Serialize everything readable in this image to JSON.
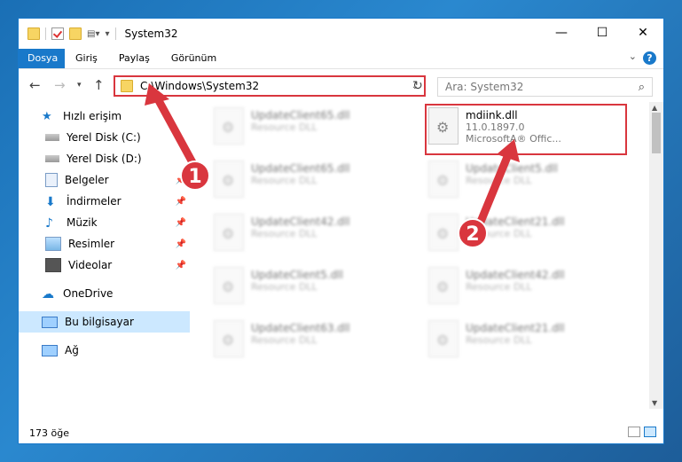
{
  "window": {
    "title": "System32",
    "controls": {
      "minimize": "—",
      "maximize": "☐",
      "close": "✕"
    }
  },
  "ribbon": {
    "tabs": [
      "Dosya",
      "Giriş",
      "Paylaş",
      "Görünüm"
    ],
    "help": "?"
  },
  "address_bar": {
    "path": "C:\\Windows\\System32",
    "search_placeholder": "Ara: System32"
  },
  "sidebar": {
    "items": [
      {
        "label": "Hızlı erişim",
        "icon": "star-icon"
      },
      {
        "label": "Yerel Disk (C:)",
        "icon": "drive-icon"
      },
      {
        "label": "Yerel Disk (D:)",
        "icon": "drive-icon"
      },
      {
        "label": "Belgeler",
        "icon": "documents-icon"
      },
      {
        "label": "İndirmeler",
        "icon": "download-icon"
      },
      {
        "label": "Müzik",
        "icon": "music-icon"
      },
      {
        "label": "Resimler",
        "icon": "pictures-icon"
      },
      {
        "label": "Videolar",
        "icon": "video-icon"
      },
      {
        "label": "OneDrive",
        "icon": "cloud-icon"
      },
      {
        "label": "Bu bilgisayar",
        "icon": "computer-icon"
      },
      {
        "label": "Ağ",
        "icon": "network-icon"
      }
    ]
  },
  "files": {
    "highlighted": {
      "name": "mdiink.dll",
      "version": "11.0.1897.0",
      "company": "MicrosoftA® Offic..."
    },
    "left_column": [
      {
        "name": "UpdateClient65.dll",
        "type": "Resource DLL"
      },
      {
        "name": "UpdateClient65.dll",
        "type": "Resource DLL"
      },
      {
        "name": "UpdateClient42.dll",
        "type": "Resource DLL"
      },
      {
        "name": "UpdateClient5.dll",
        "type": "Resource DLL"
      },
      {
        "name": "UpdateClient63.dll",
        "type": "Resource DLL"
      }
    ],
    "right_column": [
      {
        "name": "UpdateClient5.dll",
        "type": "Resource DLL"
      },
      {
        "name": "UpdateClient21.dll",
        "type": "Resource DLL"
      },
      {
        "name": "UpdateClient42.dll",
        "type": "Resource DLL"
      },
      {
        "name": "UpdateClient21.dll",
        "type": "Resource DLL"
      }
    ]
  },
  "status": {
    "count": "173 öğe"
  },
  "annotations": {
    "step1": "1",
    "step2": "2",
    "color": "#d9363e"
  }
}
